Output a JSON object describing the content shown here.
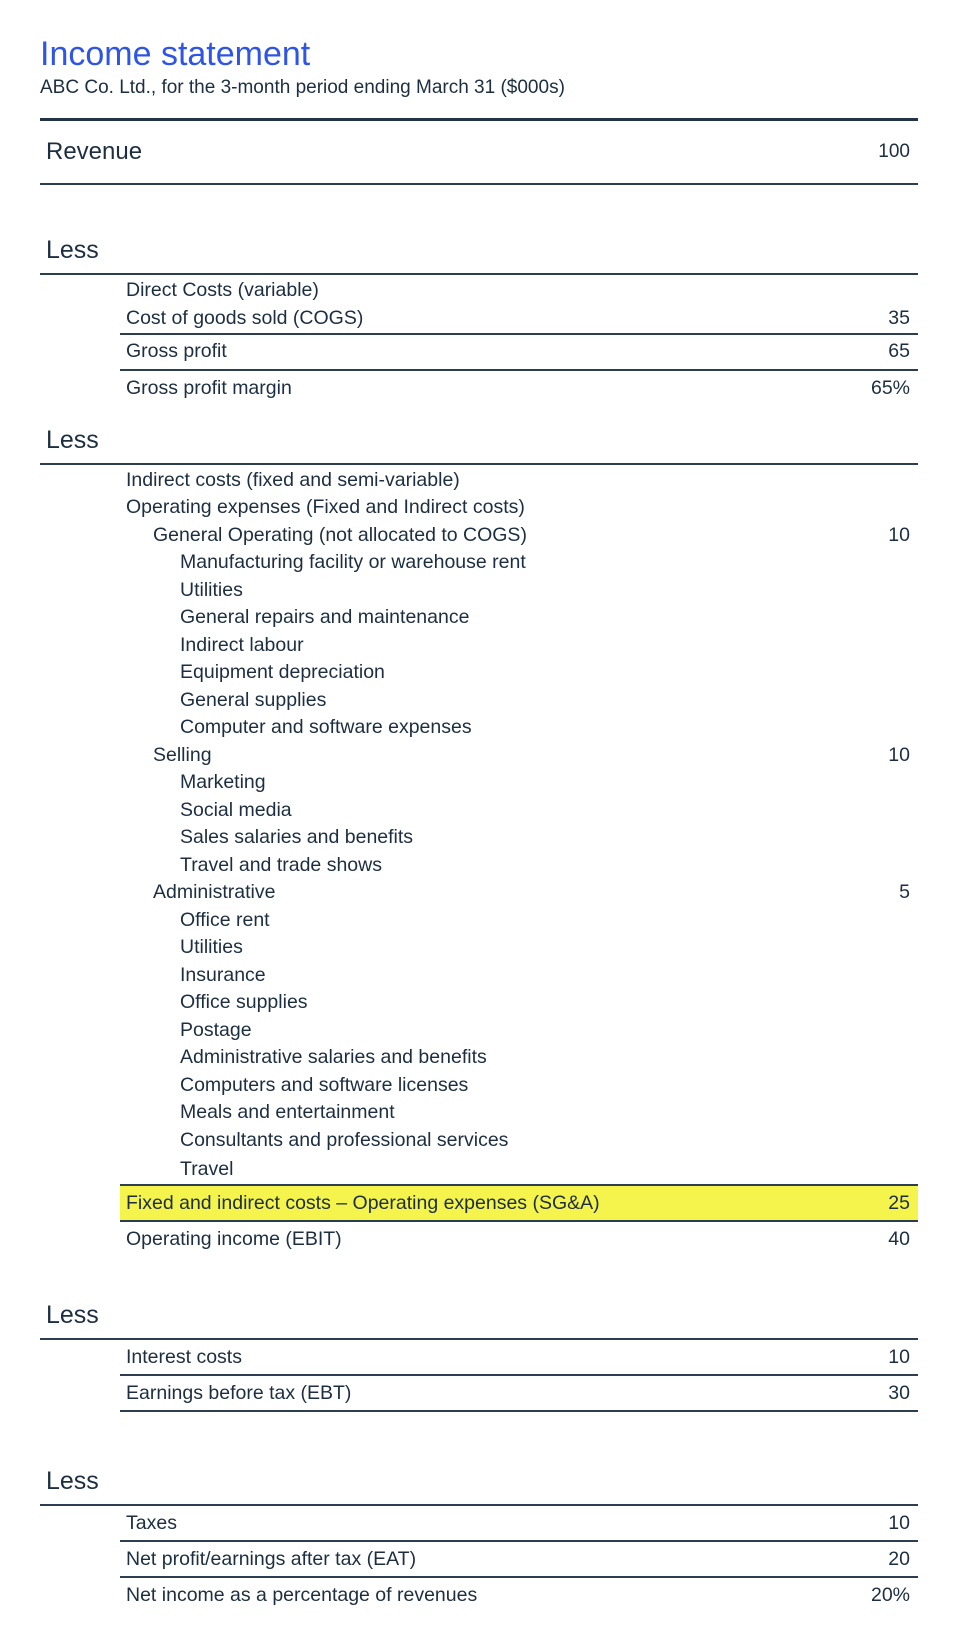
{
  "header": {
    "title": "Income statement",
    "subtitle": "ABC Co. Ltd., for the 3-month period ending March 31 ($000s)"
  },
  "colors": {
    "title": "#2f55e6",
    "text": "#1c2e40",
    "rule": "#2c3e50",
    "highlight": "#f4f44c"
  },
  "revenue": {
    "label": "Revenue",
    "value": "100"
  },
  "sections": {
    "direct": {
      "less_label": "Less",
      "heading": "Direct Costs (variable)",
      "cogs": {
        "label": "Cost of goods sold (COGS)",
        "value": "35"
      },
      "gross_profit": {
        "label": "Gross profit",
        "value": "65"
      },
      "gross_margin": {
        "label": "Gross profit margin",
        "value": "65%"
      }
    },
    "indirect": {
      "less_label": "Less",
      "heading1": "Indirect costs (fixed and semi-variable)",
      "heading2": "Operating expenses (Fixed and Indirect costs)",
      "general": {
        "label": "General Operating (not allocated to COGS)",
        "value": "10",
        "items": [
          "Manufacturing facility or warehouse rent",
          "Utilities",
          "General repairs and maintenance",
          "Indirect labour",
          "Equipment depreciation",
          "General supplies",
          "Computer and software expenses"
        ]
      },
      "selling": {
        "label": "Selling",
        "value": "10",
        "items": [
          "Marketing",
          "Social media",
          "Sales salaries and benefits",
          "Travel and trade shows"
        ]
      },
      "administrative": {
        "label": "Administrative",
        "value": "5",
        "items": [
          "Office rent",
          "Utilities",
          "Insurance",
          "Office supplies",
          "Postage",
          "Administrative salaries and benefits",
          "Computers and software licenses",
          "Meals and entertainment",
          "Consultants and professional services",
          "Travel"
        ]
      },
      "sga_total": {
        "label": "Fixed and indirect costs – Operating expenses (SG&A)",
        "value": "25"
      },
      "ebit": {
        "label": "Operating income (EBIT)",
        "value": "40"
      }
    },
    "interest": {
      "less_label": "Less",
      "interest_costs": {
        "label": "Interest costs",
        "value": "10"
      },
      "ebt": {
        "label": "Earnings before tax (EBT)",
        "value": "30"
      }
    },
    "taxes": {
      "less_label": "Less",
      "taxes": {
        "label": "Taxes",
        "value": "10"
      },
      "eat": {
        "label": "Net profit/earnings after tax (EAT)",
        "value": "20"
      },
      "net_margin": {
        "label": "Net income as a percentage of revenues",
        "value": "20%"
      }
    }
  }
}
